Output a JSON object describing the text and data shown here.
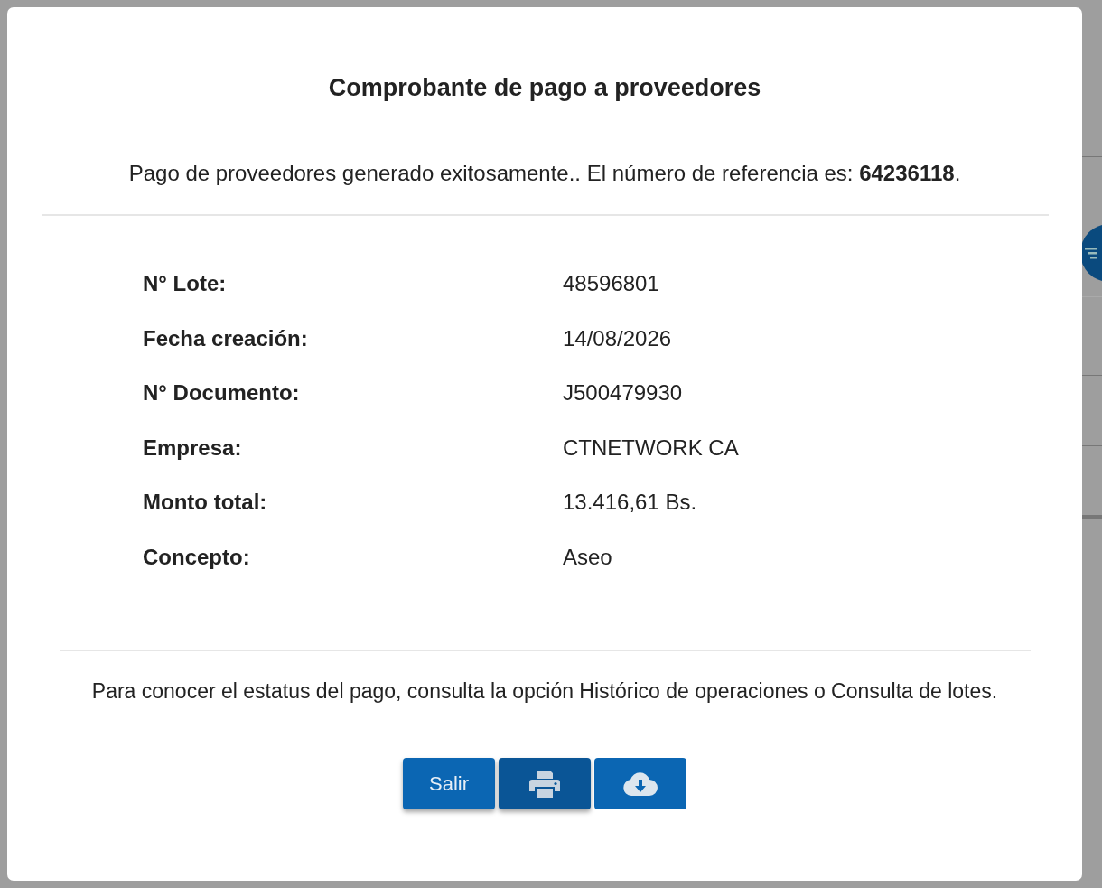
{
  "dialog": {
    "title": "Comprobante de pago a proveedores",
    "message": "Pago de proveedores generado exitosamente.. El número de referencia es: **64236118**.",
    "details": [
      {
        "label": "N° Lote:",
        "value": "48596801"
      },
      {
        "label": "Fecha creación:",
        "value": "14/08/2026"
      },
      {
        "label": "N° Documento:",
        "value": "J500479930"
      },
      {
        "label": "Empresa:",
        "value": "CTNETWORK CA"
      },
      {
        "label": "Monto total:",
        "value": "13.416,61 Bs."
      },
      {
        "label": "Concepto:",
        "value": "Aseo"
      }
    ],
    "note": "Para conocer el estatus del pago, consulta la opción Histórico de operaciones o Consulta de lotes.",
    "buttons": [
      {
        "kind": "text",
        "label": "Salir",
        "focused": false
      },
      {
        "kind": "print",
        "focused": true
      },
      {
        "kind": "download",
        "focused": false
      }
    ]
  }
}
